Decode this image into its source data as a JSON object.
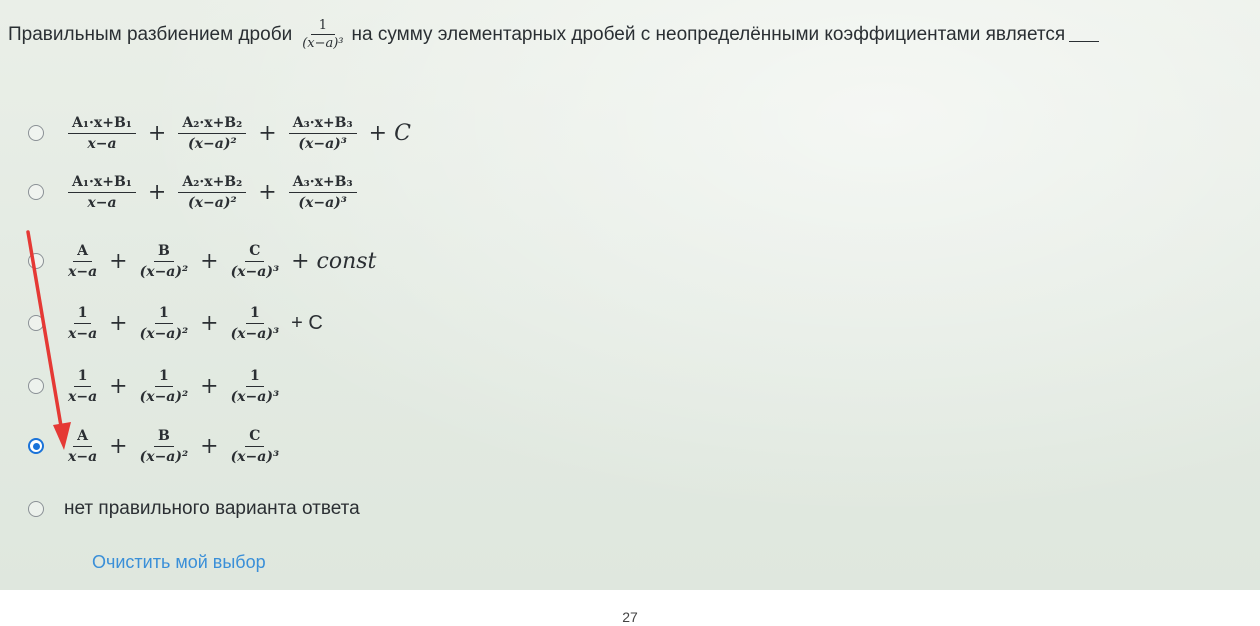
{
  "question": {
    "before": "Правильным разбиением дроби",
    "frac_num": "1",
    "frac_den": "(x−a)³",
    "after": "на сумму элементарных дробей с неопределёнными коэффициентами является"
  },
  "options": [
    {
      "terms": [
        [
          "A₁·x+B₁",
          "x−a"
        ],
        [
          "A₂·x+B₂",
          "(x−a)²"
        ],
        [
          "A₃·x+B₃",
          "(x−a)³"
        ]
      ],
      "tail": "+ C",
      "selected": false
    },
    {
      "terms": [
        [
          "A₁·x+B₁",
          "x−a"
        ],
        [
          "A₂·x+B₂",
          "(x−a)²"
        ],
        [
          "A₃·x+B₃",
          "(x−a)³"
        ]
      ],
      "tail": "",
      "selected": false
    },
    {
      "terms": [
        [
          "A",
          "x−a"
        ],
        [
          "B",
          "(x−a)²"
        ],
        [
          "C",
          "(x−a)³"
        ]
      ],
      "tail": "+ const",
      "selected": false
    },
    {
      "terms": [
        [
          "1",
          "x−a"
        ],
        [
          "1",
          "(x−a)²"
        ],
        [
          "1",
          "(x−a)³"
        ]
      ],
      "tail": "+ C",
      "selected": false
    },
    {
      "terms": [
        [
          "1",
          "x−a"
        ],
        [
          "1",
          "(x−a)²"
        ],
        [
          "1",
          "(x−a)³"
        ]
      ],
      "tail": "",
      "selected": false
    },
    {
      "terms": [
        [
          "A",
          "x−a"
        ],
        [
          "B",
          "(x−a)²"
        ],
        [
          "C",
          "(x−a)³"
        ]
      ],
      "tail": "",
      "selected": true
    }
  ],
  "none_option": {
    "label": "нет правильного варианта ответа",
    "selected": false
  },
  "clear_link": "Очистить мой выбор",
  "page_number": "27",
  "colors": {
    "selected_radio": "#1a73d9",
    "link": "#3a8fd8",
    "annotation_arrow": "#e53935"
  }
}
